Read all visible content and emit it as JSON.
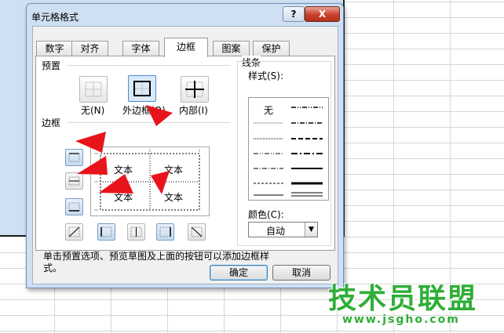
{
  "dialog": {
    "title": "单元格格式",
    "help_label": "?",
    "close_label": "X"
  },
  "tabs": [
    {
      "label": "数字"
    },
    {
      "label": "对齐"
    },
    {
      "label": "字体"
    },
    {
      "label": "边框",
      "active": true
    },
    {
      "label": "图案"
    },
    {
      "label": "保护"
    }
  ],
  "presets": {
    "group_label": "预置",
    "none_label": "无(N)",
    "outline_label": "外边框(O)",
    "inside_label": "内部(I)",
    "selected": "outline"
  },
  "border": {
    "group_label": "边框",
    "preview_texts": [
      "文本",
      "文本",
      "文本",
      "文本"
    ]
  },
  "line": {
    "group_label": "线条",
    "style_label": "样式(S):",
    "none_label": "无",
    "color_label": "颜色(C):",
    "color_value": "自动"
  },
  "hint": "单击预置选项、预览草图及上面的按钮可以添加边框样式。",
  "buttons": {
    "ok_label": "确定",
    "cancel_label": "取消"
  },
  "watermark": {
    "title": "技术员联盟",
    "url": "www.jsgho.com"
  },
  "colors": {
    "arrow": "#e8141b",
    "watermark": "#2fae37",
    "selection": "#cfe0f5"
  }
}
